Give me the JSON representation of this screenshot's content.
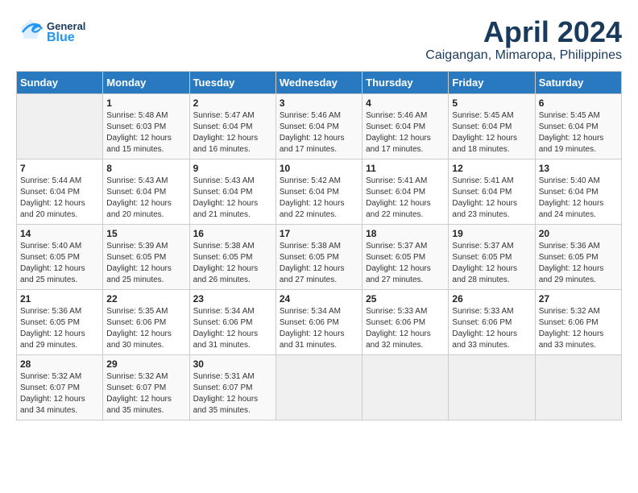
{
  "header": {
    "month_title": "April 2024",
    "location": "Caigangan, Mimaropa, Philippines",
    "logo_general": "General",
    "logo_blue": "Blue"
  },
  "calendar": {
    "weekdays": [
      "Sunday",
      "Monday",
      "Tuesday",
      "Wednesday",
      "Thursday",
      "Friday",
      "Saturday"
    ],
    "weeks": [
      [
        {
          "day": "",
          "empty": true
        },
        {
          "day": "1",
          "sunrise": "Sunrise: 5:48 AM",
          "sunset": "Sunset: 6:03 PM",
          "daylight": "Daylight: 12 hours and 15 minutes."
        },
        {
          "day": "2",
          "sunrise": "Sunrise: 5:47 AM",
          "sunset": "Sunset: 6:04 PM",
          "daylight": "Daylight: 12 hours and 16 minutes."
        },
        {
          "day": "3",
          "sunrise": "Sunrise: 5:46 AM",
          "sunset": "Sunset: 6:04 PM",
          "daylight": "Daylight: 12 hours and 17 minutes."
        },
        {
          "day": "4",
          "sunrise": "Sunrise: 5:46 AM",
          "sunset": "Sunset: 6:04 PM",
          "daylight": "Daylight: 12 hours and 17 minutes."
        },
        {
          "day": "5",
          "sunrise": "Sunrise: 5:45 AM",
          "sunset": "Sunset: 6:04 PM",
          "daylight": "Daylight: 12 hours and 18 minutes."
        },
        {
          "day": "6",
          "sunrise": "Sunrise: 5:45 AM",
          "sunset": "Sunset: 6:04 PM",
          "daylight": "Daylight: 12 hours and 19 minutes."
        }
      ],
      [
        {
          "day": "7",
          "sunrise": "Sunrise: 5:44 AM",
          "sunset": "Sunset: 6:04 PM",
          "daylight": "Daylight: 12 hours and 20 minutes."
        },
        {
          "day": "8",
          "sunrise": "Sunrise: 5:43 AM",
          "sunset": "Sunset: 6:04 PM",
          "daylight": "Daylight: 12 hours and 20 minutes."
        },
        {
          "day": "9",
          "sunrise": "Sunrise: 5:43 AM",
          "sunset": "Sunset: 6:04 PM",
          "daylight": "Daylight: 12 hours and 21 minutes."
        },
        {
          "day": "10",
          "sunrise": "Sunrise: 5:42 AM",
          "sunset": "Sunset: 6:04 PM",
          "daylight": "Daylight: 12 hours and 22 minutes."
        },
        {
          "day": "11",
          "sunrise": "Sunrise: 5:41 AM",
          "sunset": "Sunset: 6:04 PM",
          "daylight": "Daylight: 12 hours and 22 minutes."
        },
        {
          "day": "12",
          "sunrise": "Sunrise: 5:41 AM",
          "sunset": "Sunset: 6:04 PM",
          "daylight": "Daylight: 12 hours and 23 minutes."
        },
        {
          "day": "13",
          "sunrise": "Sunrise: 5:40 AM",
          "sunset": "Sunset: 6:04 PM",
          "daylight": "Daylight: 12 hours and 24 minutes."
        }
      ],
      [
        {
          "day": "14",
          "sunrise": "Sunrise: 5:40 AM",
          "sunset": "Sunset: 6:05 PM",
          "daylight": "Daylight: 12 hours and 25 minutes."
        },
        {
          "day": "15",
          "sunrise": "Sunrise: 5:39 AM",
          "sunset": "Sunset: 6:05 PM",
          "daylight": "Daylight: 12 hours and 25 minutes."
        },
        {
          "day": "16",
          "sunrise": "Sunrise: 5:38 AM",
          "sunset": "Sunset: 6:05 PM",
          "daylight": "Daylight: 12 hours and 26 minutes."
        },
        {
          "day": "17",
          "sunrise": "Sunrise: 5:38 AM",
          "sunset": "Sunset: 6:05 PM",
          "daylight": "Daylight: 12 hours and 27 minutes."
        },
        {
          "day": "18",
          "sunrise": "Sunrise: 5:37 AM",
          "sunset": "Sunset: 6:05 PM",
          "daylight": "Daylight: 12 hours and 27 minutes."
        },
        {
          "day": "19",
          "sunrise": "Sunrise: 5:37 AM",
          "sunset": "Sunset: 6:05 PM",
          "daylight": "Daylight: 12 hours and 28 minutes."
        },
        {
          "day": "20",
          "sunrise": "Sunrise: 5:36 AM",
          "sunset": "Sunset: 6:05 PM",
          "daylight": "Daylight: 12 hours and 29 minutes."
        }
      ],
      [
        {
          "day": "21",
          "sunrise": "Sunrise: 5:36 AM",
          "sunset": "Sunset: 6:05 PM",
          "daylight": "Daylight: 12 hours and 29 minutes."
        },
        {
          "day": "22",
          "sunrise": "Sunrise: 5:35 AM",
          "sunset": "Sunset: 6:06 PM",
          "daylight": "Daylight: 12 hours and 30 minutes."
        },
        {
          "day": "23",
          "sunrise": "Sunrise: 5:34 AM",
          "sunset": "Sunset: 6:06 PM",
          "daylight": "Daylight: 12 hours and 31 minutes."
        },
        {
          "day": "24",
          "sunrise": "Sunrise: 5:34 AM",
          "sunset": "Sunset: 6:06 PM",
          "daylight": "Daylight: 12 hours and 31 minutes."
        },
        {
          "day": "25",
          "sunrise": "Sunrise: 5:33 AM",
          "sunset": "Sunset: 6:06 PM",
          "daylight": "Daylight: 12 hours and 32 minutes."
        },
        {
          "day": "26",
          "sunrise": "Sunrise: 5:33 AM",
          "sunset": "Sunset: 6:06 PM",
          "daylight": "Daylight: 12 hours and 33 minutes."
        },
        {
          "day": "27",
          "sunrise": "Sunrise: 5:32 AM",
          "sunset": "Sunset: 6:06 PM",
          "daylight": "Daylight: 12 hours and 33 minutes."
        }
      ],
      [
        {
          "day": "28",
          "sunrise": "Sunrise: 5:32 AM",
          "sunset": "Sunset: 6:07 PM",
          "daylight": "Daylight: 12 hours and 34 minutes."
        },
        {
          "day": "29",
          "sunrise": "Sunrise: 5:32 AM",
          "sunset": "Sunset: 6:07 PM",
          "daylight": "Daylight: 12 hours and 35 minutes."
        },
        {
          "day": "30",
          "sunrise": "Sunrise: 5:31 AM",
          "sunset": "Sunset: 6:07 PM",
          "daylight": "Daylight: 12 hours and 35 minutes."
        },
        {
          "day": "",
          "empty": true
        },
        {
          "day": "",
          "empty": true
        },
        {
          "day": "",
          "empty": true
        },
        {
          "day": "",
          "empty": true
        }
      ]
    ]
  }
}
